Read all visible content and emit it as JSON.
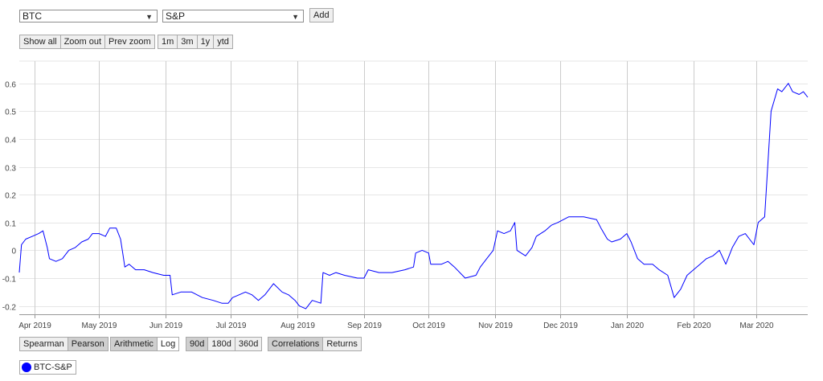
{
  "controls": {
    "select1": "BTC",
    "select2": "S&P",
    "add_label": "Add",
    "zoom_buttons": [
      "Show all",
      "Zoom out",
      "Prev zoom"
    ],
    "range_buttons": [
      "1m",
      "3m",
      "1y",
      "ytd"
    ]
  },
  "bottom_controls": {
    "method": [
      "Spearman",
      "Pearson"
    ],
    "scale": [
      "Arithmetic",
      "Log"
    ],
    "window": [
      "90d",
      "180d",
      "360d"
    ],
    "view": [
      "Correlations",
      "Returns"
    ]
  },
  "legend": {
    "label": "BTC-S&P",
    "color": "#0000ff"
  },
  "chart_data": {
    "type": "line",
    "title": "",
    "xlabel": "",
    "ylabel": "",
    "ylim": [
      -0.23,
      0.68
    ],
    "yticks": [
      -0.2,
      -0.1,
      0,
      0.1,
      0.2,
      0.3,
      0.4,
      0.5,
      0.6
    ],
    "ytick_labels": [
      "-0.2",
      "-0.1",
      "0",
      "0.1",
      "0.2",
      "0.3",
      "0.4",
      "0.5",
      "0.6"
    ],
    "xlim": [
      "2019-03-25",
      "2020-03-25"
    ],
    "xticks": [
      "2019-04-01",
      "2019-05-01",
      "2019-06-01",
      "2019-07-01",
      "2019-08-01",
      "2019-09-01",
      "2019-10-01",
      "2019-11-01",
      "2019-12-01",
      "2020-01-01",
      "2020-02-01",
      "2020-03-01"
    ],
    "xtick_labels": [
      "Apr 2019",
      "May 2019",
      "Jun 2019",
      "Jul 2019",
      "Aug 2019",
      "Sep 2019",
      "Oct 2019",
      "Nov 2019",
      "Dec 2019",
      "Jan 2020",
      "Feb 2020",
      "Mar 2020"
    ],
    "grid": true,
    "legend_position": "bottom-left",
    "series": [
      {
        "name": "BTC-S&P",
        "color": "#0000ff",
        "points": [
          [
            "2019-03-25",
            -0.08
          ],
          [
            "2019-03-26",
            0.02
          ],
          [
            "2019-03-28",
            0.04
          ],
          [
            "2019-03-31",
            0.05
          ],
          [
            "2019-04-03",
            0.06
          ],
          [
            "2019-04-05",
            0.07
          ],
          [
            "2019-04-07",
            0.01
          ],
          [
            "2019-04-08",
            -0.03
          ],
          [
            "2019-04-11",
            -0.04
          ],
          [
            "2019-04-14",
            -0.03
          ],
          [
            "2019-04-17",
            0.0
          ],
          [
            "2019-04-20",
            0.01
          ],
          [
            "2019-04-23",
            0.03
          ],
          [
            "2019-04-26",
            0.04
          ],
          [
            "2019-04-28",
            0.06
          ],
          [
            "2019-05-01",
            0.06
          ],
          [
            "2019-05-04",
            0.05
          ],
          [
            "2019-05-06",
            0.08
          ],
          [
            "2019-05-09",
            0.08
          ],
          [
            "2019-05-11",
            0.04
          ],
          [
            "2019-05-12",
            -0.01
          ],
          [
            "2019-05-13",
            -0.06
          ],
          [
            "2019-05-15",
            -0.05
          ],
          [
            "2019-05-18",
            -0.07
          ],
          [
            "2019-05-22",
            -0.07
          ],
          [
            "2019-05-26",
            -0.08
          ],
          [
            "2019-05-31",
            -0.09
          ],
          [
            "2019-06-03",
            -0.09
          ],
          [
            "2019-06-04",
            -0.16
          ],
          [
            "2019-06-08",
            -0.15
          ],
          [
            "2019-06-13",
            -0.15
          ],
          [
            "2019-06-18",
            -0.17
          ],
          [
            "2019-06-23",
            -0.18
          ],
          [
            "2019-06-27",
            -0.19
          ],
          [
            "2019-06-30",
            -0.19
          ],
          [
            "2019-07-02",
            -0.17
          ],
          [
            "2019-07-05",
            -0.16
          ],
          [
            "2019-07-08",
            -0.15
          ],
          [
            "2019-07-11",
            -0.16
          ],
          [
            "2019-07-14",
            -0.18
          ],
          [
            "2019-07-17",
            -0.16
          ],
          [
            "2019-07-21",
            -0.12
          ],
          [
            "2019-07-25",
            -0.15
          ],
          [
            "2019-07-28",
            -0.16
          ],
          [
            "2019-07-31",
            -0.18
          ],
          [
            "2019-08-02",
            -0.2
          ],
          [
            "2019-08-05",
            -0.21
          ],
          [
            "2019-08-08",
            -0.18
          ],
          [
            "2019-08-12",
            -0.19
          ],
          [
            "2019-08-13",
            -0.08
          ],
          [
            "2019-08-16",
            -0.09
          ],
          [
            "2019-08-19",
            -0.08
          ],
          [
            "2019-08-23",
            -0.09
          ],
          [
            "2019-08-29",
            -0.1
          ],
          [
            "2019-09-01",
            -0.1
          ],
          [
            "2019-09-03",
            -0.07
          ],
          [
            "2019-09-08",
            -0.08
          ],
          [
            "2019-09-14",
            -0.08
          ],
          [
            "2019-09-20",
            -0.07
          ],
          [
            "2019-09-24",
            -0.06
          ],
          [
            "2019-09-25",
            -0.01
          ],
          [
            "2019-09-28",
            0.0
          ],
          [
            "2019-10-01",
            -0.01
          ],
          [
            "2019-10-02",
            -0.05
          ],
          [
            "2019-10-07",
            -0.05
          ],
          [
            "2019-10-10",
            -0.04
          ],
          [
            "2019-10-13",
            -0.06
          ],
          [
            "2019-10-18",
            -0.1
          ],
          [
            "2019-10-23",
            -0.09
          ],
          [
            "2019-10-25",
            -0.06
          ],
          [
            "2019-10-28",
            -0.03
          ],
          [
            "2019-10-31",
            0.0
          ],
          [
            "2019-11-02",
            0.07
          ],
          [
            "2019-11-05",
            0.06
          ],
          [
            "2019-11-08",
            0.07
          ],
          [
            "2019-11-10",
            0.1
          ],
          [
            "2019-11-11",
            0.0
          ],
          [
            "2019-11-15",
            -0.02
          ],
          [
            "2019-11-18",
            0.01
          ],
          [
            "2019-11-20",
            0.05
          ],
          [
            "2019-11-24",
            0.07
          ],
          [
            "2019-11-27",
            0.09
          ],
          [
            "2019-11-30",
            0.1
          ],
          [
            "2019-12-05",
            0.12
          ],
          [
            "2019-12-12",
            0.12
          ],
          [
            "2019-12-18",
            0.11
          ],
          [
            "2019-12-20",
            0.08
          ],
          [
            "2019-12-23",
            0.04
          ],
          [
            "2019-12-25",
            0.03
          ],
          [
            "2019-12-29",
            0.04
          ],
          [
            "2020-01-01",
            0.06
          ],
          [
            "2020-01-03",
            0.03
          ],
          [
            "2020-01-06",
            -0.03
          ],
          [
            "2020-01-09",
            -0.05
          ],
          [
            "2020-01-13",
            -0.05
          ],
          [
            "2020-01-16",
            -0.07
          ],
          [
            "2020-01-20",
            -0.09
          ],
          [
            "2020-01-23",
            -0.17
          ],
          [
            "2020-01-26",
            -0.14
          ],
          [
            "2020-01-29",
            -0.09
          ],
          [
            "2020-02-01",
            -0.07
          ],
          [
            "2020-02-04",
            -0.05
          ],
          [
            "2020-02-07",
            -0.03
          ],
          [
            "2020-02-10",
            -0.02
          ],
          [
            "2020-02-13",
            0.0
          ],
          [
            "2020-02-16",
            -0.05
          ],
          [
            "2020-02-19",
            0.01
          ],
          [
            "2020-02-22",
            0.05
          ],
          [
            "2020-02-25",
            0.06
          ],
          [
            "2020-02-29",
            0.02
          ],
          [
            "2020-03-02",
            0.1
          ],
          [
            "2020-03-05",
            0.12
          ],
          [
            "2020-03-08",
            0.5
          ],
          [
            "2020-03-11",
            0.58
          ],
          [
            "2020-03-13",
            0.57
          ],
          [
            "2020-03-16",
            0.6
          ],
          [
            "2020-03-18",
            0.57
          ],
          [
            "2020-03-21",
            0.56
          ],
          [
            "2020-03-23",
            0.57
          ],
          [
            "2020-03-25",
            0.55
          ]
        ]
      }
    ]
  }
}
